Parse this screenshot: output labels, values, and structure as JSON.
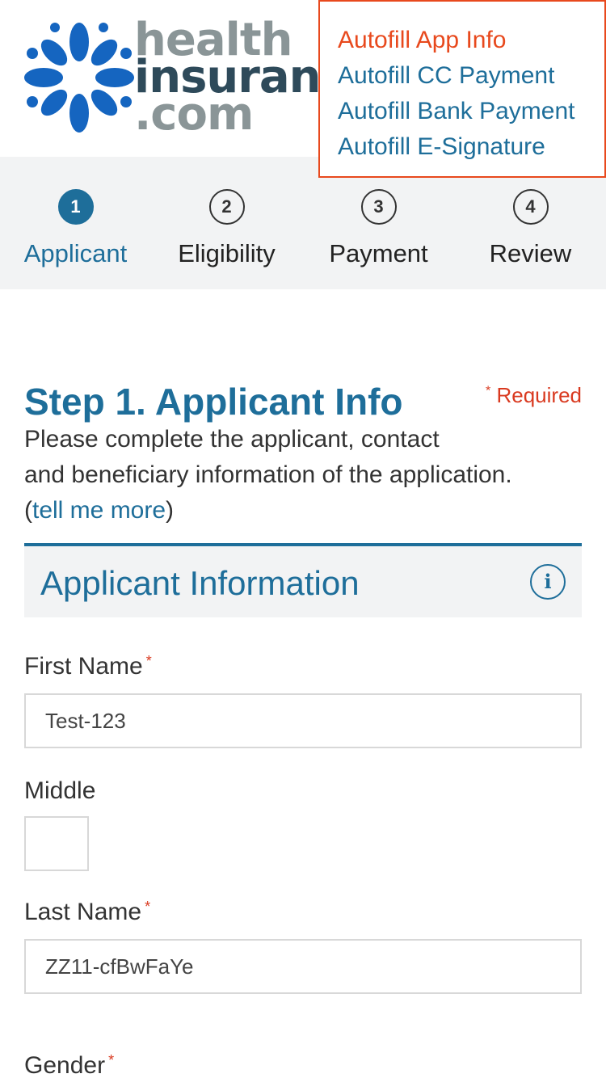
{
  "header": {
    "logo_lines": [
      "health",
      "insuran",
      ".com"
    ],
    "autofill_menu": [
      {
        "label": "Autofill App Info",
        "active": true
      },
      {
        "label": "Autofill CC Payment",
        "active": false
      },
      {
        "label": "Autofill Bank Payment",
        "active": false
      },
      {
        "label": "Autofill E-Signature",
        "active": false
      }
    ]
  },
  "steps": [
    {
      "num": "1",
      "label": "Applicant",
      "active": true
    },
    {
      "num": "2",
      "label": "Eligibility",
      "active": false
    },
    {
      "num": "3",
      "label": "Payment",
      "active": false
    },
    {
      "num": "4",
      "label": "Review",
      "active": false
    }
  ],
  "main": {
    "title": "Step 1. Applicant Info",
    "required_star": "*",
    "required_label": "Required",
    "intro_line1": "Please complete the applicant, contact",
    "intro_line2": "and beneficiary information of the application.",
    "intro_open": "(",
    "intro_link": "tell me more",
    "intro_close": ")",
    "section_title": "Applicant Information",
    "info_icon": "i"
  },
  "form": {
    "first_name_label": "First Name",
    "first_name_value": "Test-123",
    "middle_label": "Middle",
    "middle_value": "",
    "last_name_label": "Last Name",
    "last_name_value": "ZZ11-cfBwFaYe",
    "gender_label": "Gender",
    "required_marker": "*"
  },
  "colors": {
    "brand_blue": "#1e6e9a",
    "accent_orange": "#e8491d",
    "required_red": "#d9391f",
    "logo_petal_blue": "#1565c0",
    "logo_gray": "#8a9597"
  }
}
